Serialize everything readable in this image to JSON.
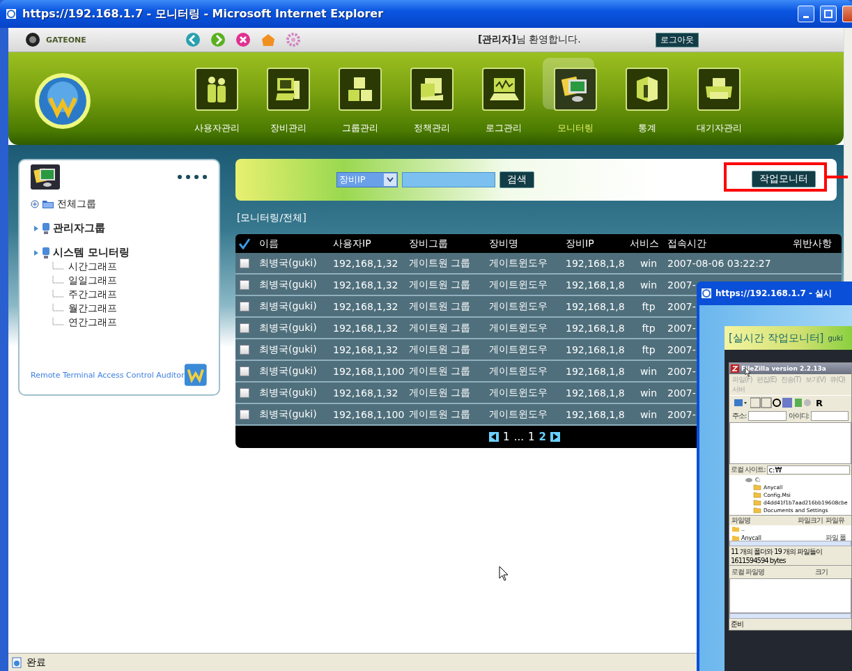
{
  "window": {
    "title": "https://192.168.1.7 - 모니터링 - Microsoft Internet Explorer"
  },
  "header": {
    "brand": "GATEONE",
    "welcome": "**[관리자]**님 환영합니다.",
    "logout": "로그아웃"
  },
  "menu": [
    {
      "label": "사용자관리",
      "kind": "users",
      "selected": false
    },
    {
      "label": "장비관리",
      "kind": "devices",
      "selected": false
    },
    {
      "label": "그룹관리",
      "kind": "groups",
      "selected": false
    },
    {
      "label": "정책관리",
      "kind": "policy",
      "selected": false
    },
    {
      "label": "로그관리",
      "kind": "logs",
      "selected": false
    },
    {
      "label": "모니터링",
      "kind": "monitor",
      "selected": true
    },
    {
      "label": "통계",
      "kind": "stats",
      "selected": false
    },
    {
      "label": "대기자관리",
      "kind": "waiting",
      "selected": false
    }
  ],
  "sidebar": {
    "tree": [
      {
        "label": "전체그룹",
        "kind": "folder"
      },
      {
        "label": "관리자그룹",
        "kind": "group"
      },
      {
        "label": "시스템 모니터링",
        "kind": "group",
        "children": [
          {
            "label": "시간그래프",
            "kind": "leaf"
          },
          {
            "label": "일일그래프",
            "kind": "leaf"
          },
          {
            "label": "주간그래프",
            "kind": "leaf"
          },
          {
            "label": "월간그래프",
            "kind": "leaf"
          },
          {
            "label": "연간그래프",
            "kind": "leaf"
          }
        ]
      }
    ],
    "footer": "Remote Terminal Access Control Auditor"
  },
  "search": {
    "select": "장비IP",
    "button": "검색",
    "monitor_button": "작업모니터"
  },
  "breadcrumb": "[모니터링/전체]",
  "table": {
    "columns": [
      "이름",
      "사용자IP",
      "장비그룹",
      "장비명",
      "장비IP",
      "서비스",
      "접속시간",
      "위반사항"
    ],
    "rows": [
      {
        "checked": false,
        "cells": [
          "최병국(guki)",
          "192,168,1,32",
          "게이트원 그룹",
          "게이트윈도우",
          "192,168,1,8",
          "win",
          "2007-08-06 03:22:27"
        ]
      },
      {
        "checked": false,
        "cells": [
          "최병국(guki)",
          "192,168,1,32",
          "게이트원 그룹",
          "게이트윈도우",
          "192,168,1,8",
          "win",
          "2007-"
        ]
      },
      {
        "checked": false,
        "cells": [
          "최병국(guki)",
          "192,168,1,32",
          "게이트원 그룹",
          "게이트윈도우",
          "192,168,1,8",
          "ftp",
          "2007-"
        ]
      },
      {
        "checked": false,
        "cells": [
          "최병국(guki)",
          "192,168,1,32",
          "게이트원 그룹",
          "게이트윈도우",
          "192,168,1,8",
          "ftp",
          "2007-"
        ]
      },
      {
        "checked": false,
        "cells": [
          "최병국(guki)",
          "192,168,1,32",
          "게이트원 그룹",
          "게이트윈도우",
          "192,168,1,8",
          "ftp",
          "2007-"
        ]
      },
      {
        "checked": false,
        "cells": [
          "최병국(guki)",
          "192,168,1,100",
          "게이트원 그룹",
          "게이트윈도우",
          "192,168,1,8",
          "win",
          "2007-"
        ]
      },
      {
        "checked": false,
        "cells": [
          "최병국(guki)",
          "192,168,1,32",
          "게이트원 그룹",
          "게이트윈도우",
          "192,168,1,8",
          "win",
          "2007-"
        ]
      },
      {
        "checked": false,
        "cells": [
          "최병국(guki)",
          "192,168,1,100",
          "게이트원 그룹",
          "게이트윈도우",
          "192,168,1,8",
          "win",
          "2007-"
        ]
      }
    ]
  },
  "pagination": [
    {
      "label": "1",
      "selected": false
    },
    {
      "label": "...",
      "selected": false
    },
    {
      "label": "1",
      "selected": false
    },
    {
      "label": "2",
      "selected": true
    }
  ],
  "status_bar": {
    "text": "완료"
  },
  "popup": {
    "title": "https://192.168.1.7 - 실시",
    "heading": "[실시간 작업모니터]",
    "user": "guki",
    "app": {
      "title": "FileZilla version 2.2.13a",
      "menu": [
        "파일(F)",
        "편집(E)",
        "전송(T)",
        "보기(V)",
        "큐(Q)",
        "서버"
      ],
      "toolbar_letter": "R",
      "address_label": "주소:",
      "user_label": "아이디:",
      "local_site_label": "로컬 사이트:",
      "local_site_value": "c:₩",
      "tree": [
        {
          "label": "C:",
          "children": [
            {
              "label": "Anycall"
            },
            {
              "label": "Config.Msi"
            },
            {
              "label": "d4dd41f1b7aad216bb19608cbe"
            },
            {
              "label": "Documents and Settings"
            }
          ]
        }
      ],
      "file_columns": [
        "파일명",
        "파일크기",
        "파일유"
      ],
      "files": [
        {
          "name": ".."
        },
        {
          "name": "Anycall",
          "type": "파일 폴"
        }
      ],
      "summary": "11 개의 폴더와 19 개의 파일들이 1611594594 bytes",
      "queue_columns": [
        "로컬 파일명",
        "크기"
      ],
      "status": "준비"
    }
  }
}
